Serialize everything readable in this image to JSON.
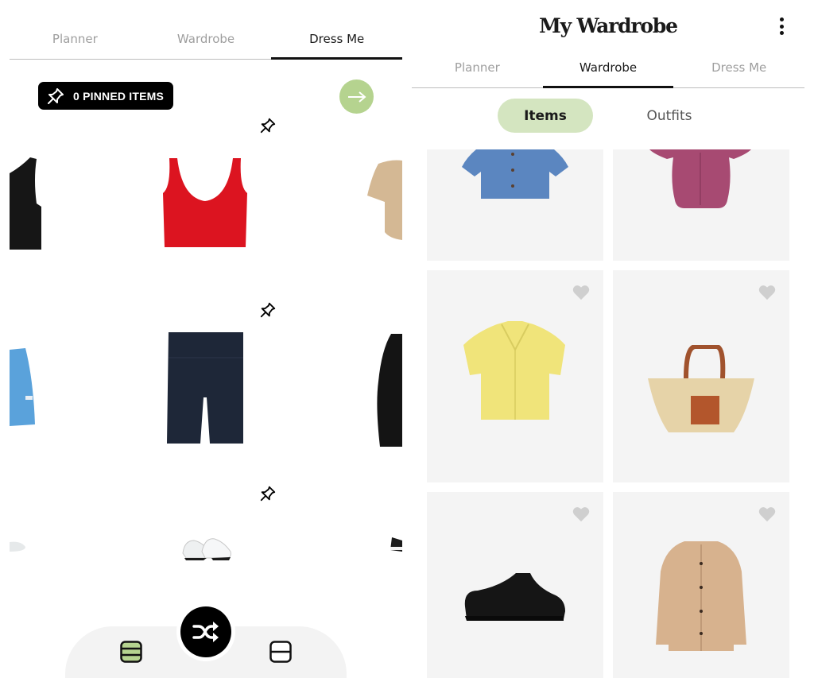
{
  "left_screen": {
    "tabs": [
      {
        "label": "Planner",
        "active": false
      },
      {
        "label": "Wardrobe",
        "active": false
      },
      {
        "label": "Dress Me",
        "active": true
      }
    ],
    "pinned_button": {
      "label": "0 PINNED ITEMS",
      "icon": "pin-icon"
    },
    "next_button": {
      "icon": "arrow-right-icon",
      "color": "#b5d38f"
    },
    "rows": [
      {
        "category": "tops",
        "items": [
          "black tank top",
          "red crop tank top",
          "beige t-shirt"
        ],
        "pinned": false
      },
      {
        "category": "bottoms",
        "items": [
          "blue shorts",
          "navy bike shorts",
          "black leggings"
        ],
        "pinned": false
      },
      {
        "category": "shoes",
        "items": [
          "white sneakers",
          "white chunky sneakers",
          "black sneakers"
        ],
        "pinned": false
      }
    ],
    "bottom_bar": {
      "left_icon": "three-row-layout-icon",
      "center_icon": "shuffle-icon",
      "right_icon": "two-row-layout-icon",
      "active_layout": "three-row"
    }
  },
  "right_screen": {
    "title": "My Wardrobe",
    "menu_icon": "more-vertical-icon",
    "tabs": [
      {
        "label": "Planner",
        "active": false
      },
      {
        "label": "Wardrobe",
        "active": true
      },
      {
        "label": "Dress Me",
        "active": false
      }
    ],
    "segments": [
      {
        "label": "Items",
        "active": true
      },
      {
        "label": "Outfits",
        "active": false
      }
    ],
    "items": [
      {
        "name": "blue short-sleeve shirt",
        "favorite": false
      },
      {
        "name": "magenta blouse",
        "favorite": false
      },
      {
        "name": "yellow knit shirt",
        "favorite": false
      },
      {
        "name": "straw tote bag",
        "favorite": false
      },
      {
        "name": "black sneakers",
        "favorite": false
      },
      {
        "name": "camel wool overshirt",
        "favorite": false
      }
    ],
    "accent_color": "#d4e5c0"
  }
}
